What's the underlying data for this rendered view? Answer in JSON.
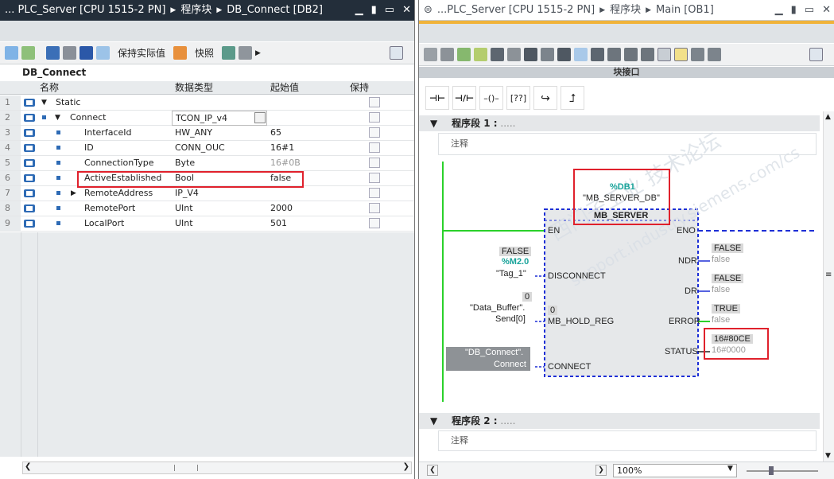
{
  "left": {
    "title_parts": [
      "...  PLC_Server [CPU 1515-2 PN]",
      "程序块",
      "DB_Connect [DB2]"
    ],
    "toolbar": {
      "keep_actual_label": "保持实际值",
      "snapshot_label": "快照"
    },
    "db_name": "DB_Connect",
    "headers": {
      "name": "名称",
      "type": "数据类型",
      "start": "起始值",
      "retain": "保持"
    },
    "rows": [
      {
        "n": "1",
        "name": "Static",
        "type": "",
        "start": ""
      },
      {
        "n": "2",
        "name": "Connect",
        "type": "TCON_IP_v4",
        "start": ""
      },
      {
        "n": "3",
        "name": "InterfaceId",
        "type": "HW_ANY",
        "start": "65"
      },
      {
        "n": "4",
        "name": "ID",
        "type": "CONN_OUC",
        "start": "16#1"
      },
      {
        "n": "5",
        "name": "ConnectionType",
        "type": "Byte",
        "start": "16#0B"
      },
      {
        "n": "6",
        "name": "ActiveEstablished",
        "type": "Bool",
        "start": "false"
      },
      {
        "n": "7",
        "name": "RemoteAddress",
        "type": "IP_V4",
        "start": ""
      },
      {
        "n": "8",
        "name": "RemotePort",
        "type": "UInt",
        "start": "2000"
      },
      {
        "n": "9",
        "name": "LocalPort",
        "type": "UInt",
        "start": "501"
      }
    ]
  },
  "right": {
    "title_parts": [
      "...PLC_Server [CPU 1515-2 PN]",
      "程序块",
      "Main [OB1]"
    ],
    "block_interface_label": "块接口",
    "seg1_label": "程序段 1 :",
    "seg1_dots": ".....",
    "seg2_label": "程序段 2 :",
    "seg2_dots": ".....",
    "comment_label": "注释",
    "comment2_label": "注释",
    "instance_db": "%DB1",
    "instance_db_name": "\"MB_SERVER_DB\"",
    "block_name": "MB_SERVER",
    "pins": {
      "en": "EN",
      "eno": "ENO",
      "disconnect": "DISCONNECT",
      "mb_hold_reg": "MB_HOLD_REG",
      "connect": "CONNECT",
      "ndr": "NDR",
      "dr": "DR",
      "error": "ERROR",
      "status": "STATUS"
    },
    "inputs": {
      "disc_val": "FALSE",
      "disc_addr": "%M2.0",
      "disc_tag": "\"Tag_1\"",
      "hold_val": "0",
      "hold_tag1": "\"Data_Buffer\".",
      "hold_tag2": "Send[0]",
      "hold_inline": "0",
      "conn_tag1": "\"DB_Connect\".",
      "conn_tag2": "Connect"
    },
    "outputs": {
      "ndr_val": "FALSE",
      "ndr_sub": "false",
      "dr_val": "FALSE",
      "dr_sub": "false",
      "err_val": "TRUE",
      "err_sub": "false",
      "status_val": "16#80CE",
      "status_sub": "16#0000"
    },
    "zoom": "100%",
    "watermark1": "西门子工业 技术论坛",
    "watermark2": "support.industry.siemens.com/cs"
  },
  "colors": {
    "highlight_red": "#e0212c",
    "ladder_green": "#2ad12a",
    "block_blue": "#1d2fd6",
    "teal_addr": "#18a39a"
  }
}
